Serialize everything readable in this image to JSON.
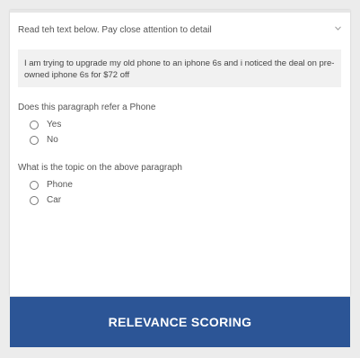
{
  "instruction": "Read teh text below. Pay close attention to detail",
  "passage": "I am trying to upgrade my old phone to an iphone 6s and i noticed the deal on pre-owned iphone 6s for $72 off",
  "questions": [
    {
      "text": "Does this paragraph refer a Phone",
      "options": [
        "Yes",
        "No"
      ]
    },
    {
      "text": "What is the topic on the above paragraph",
      "options": [
        "Phone",
        "Car"
      ]
    }
  ],
  "banner": {
    "label": "RELEVANCE SCORING"
  },
  "colors": {
    "banner": "#2c5596",
    "passage_bg": "#f1f1f1",
    "background": "#ececec"
  },
  "icons": {
    "scroll": "chevron-down-icon"
  }
}
